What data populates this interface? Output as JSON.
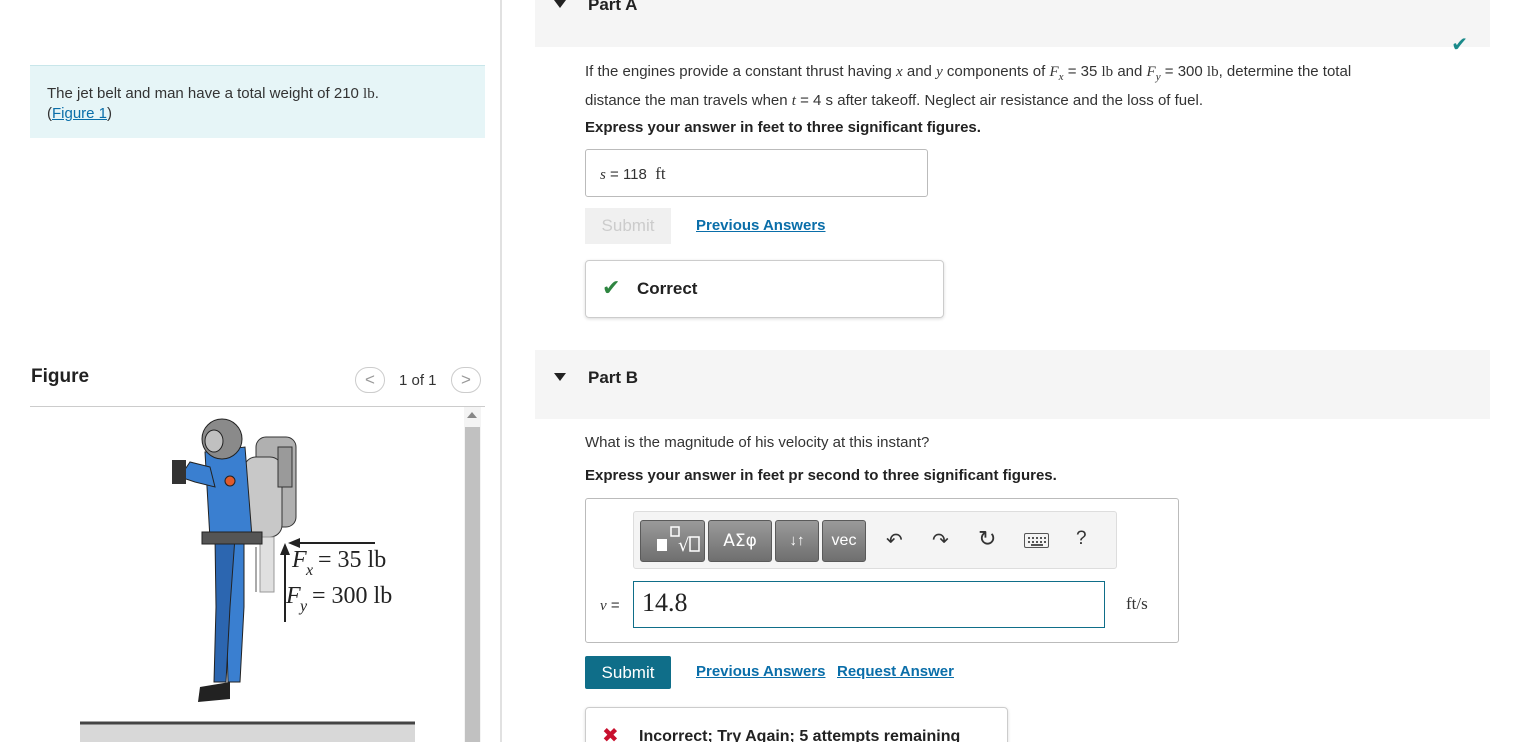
{
  "problem": {
    "text": "The jet belt and man have a total weight of 210 ",
    "weight_unit": "lb",
    "figure_link_open": "(",
    "figure_link": "Figure 1",
    "figure_link_close": ")"
  },
  "figure": {
    "title": "Figure",
    "page_count": "1 of 1",
    "prev_icon": "<",
    "next_icon": ">",
    "label_fx": "= 35 lb",
    "label_fy": "= 300 lb",
    "fx_symbol": "F",
    "fx_sub": "x",
    "fy_symbol": "F",
    "fy_sub": "y"
  },
  "partA": {
    "title": "Part A",
    "question_1": "If the engines provide a constant thrust having ",
    "var_x": "x",
    "and_1": " and ",
    "var_y": "y",
    "question_2": " components of ",
    "fx": "F",
    "fx_sub": "x",
    "fx_val": " = 35 ",
    "lb1": "lb",
    "and_2": " and ",
    "fy": "F",
    "fy_sub": "y",
    "fy_val": " = 300 ",
    "lb2": "lb",
    "question_3": ", determine the total",
    "question_line2a": "distance the man travels when ",
    "var_t": "t",
    "question_line2b": " = 4 s after takeoff. Neglect air resistance and the loss of fuel.",
    "instruction": "Express your answer in feet to three significant figures.",
    "answer_var": "s",
    "answer_eq": " =  ",
    "answer_value": "118",
    "answer_unit": "ft",
    "submit_label": "Submit",
    "previous_answers": "Previous Answers",
    "feedback": "Correct"
  },
  "partB": {
    "title": "Part B",
    "question": "What is the magnitude of his velocity at this instant?",
    "instruction": "Express your answer in feet pr second to three significant figures.",
    "toolbar": {
      "greek": "ΑΣφ",
      "arrows": "↓↑",
      "vec": "vec",
      "undo_icon": "undo-icon",
      "redo_icon": "redo-icon",
      "reset_icon": "reset-icon",
      "keyboard_icon": "keyboard-icon",
      "help": "?"
    },
    "answer_var": "v",
    "answer_eq": " =",
    "answer_value": "14.8",
    "answer_unit": "ft/s",
    "submit_label": "Submit",
    "previous_answers": "Previous Answers",
    "request_answer": "Request Answer",
    "feedback": "Incorrect; Try Again; 5 attempts remaining"
  },
  "colors": {
    "accent": "#0f6e89",
    "link": "#0a6ea9",
    "correct": "#2e8540",
    "incorrect": "#c8102e",
    "problem_bg": "#e6f5f7"
  }
}
